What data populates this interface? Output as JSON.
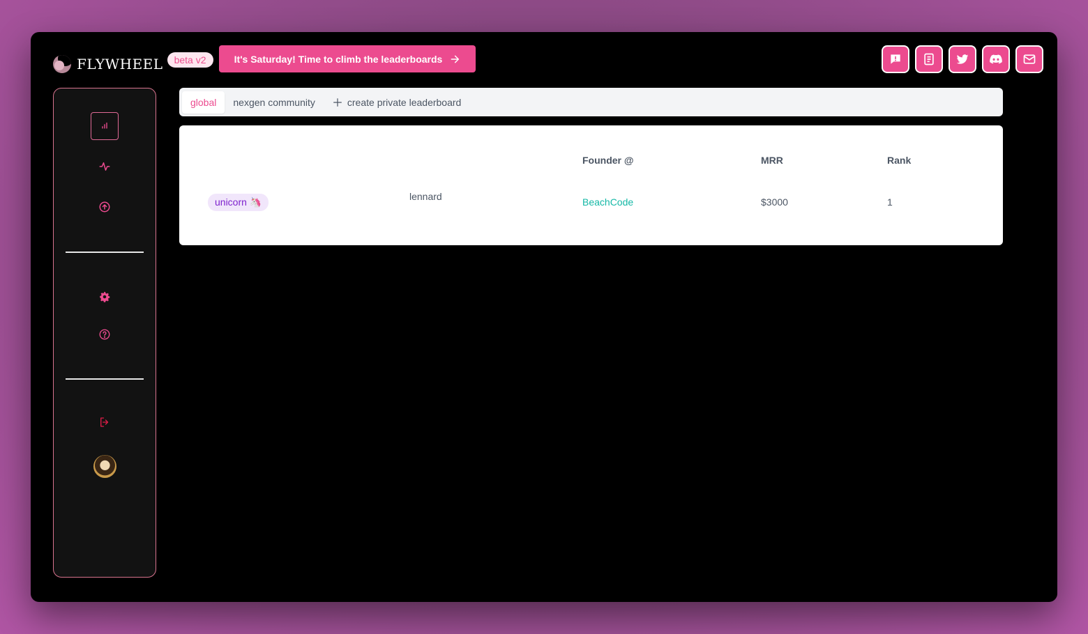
{
  "header": {
    "logo_text": "FLYWHEEL",
    "beta_badge": "beta v2",
    "promo_label": "It's Saturday! Time to climb the leaderboards",
    "icons": [
      "feedback-icon",
      "docs-icon",
      "twitter-icon",
      "discord-icon",
      "mail-icon"
    ]
  },
  "sidebar": {
    "items": [
      {
        "name": "leaderboard-icon",
        "active": true
      },
      {
        "name": "activity-icon",
        "active": false
      },
      {
        "name": "upload-icon",
        "active": false
      },
      {
        "name": "settings-icon",
        "active": false
      },
      {
        "name": "help-icon",
        "active": false
      },
      {
        "name": "logout-icon",
        "active": false
      }
    ]
  },
  "tabs": {
    "items": [
      "global",
      "nexgen community"
    ],
    "active": "global",
    "create_label": "create private leaderboard"
  },
  "table": {
    "headers": {
      "founder": "Founder @",
      "mrr": "MRR",
      "rank": "Rank"
    },
    "rows": [
      {
        "badge": "unicorn 🦄",
        "user": "lennard",
        "company": "BeachCode",
        "mrr": "$3000",
        "rank": "1"
      }
    ]
  },
  "colors": {
    "accent": "#ec4b8f",
    "company": "#14b8a6",
    "badge_text": "#7e22ce"
  }
}
